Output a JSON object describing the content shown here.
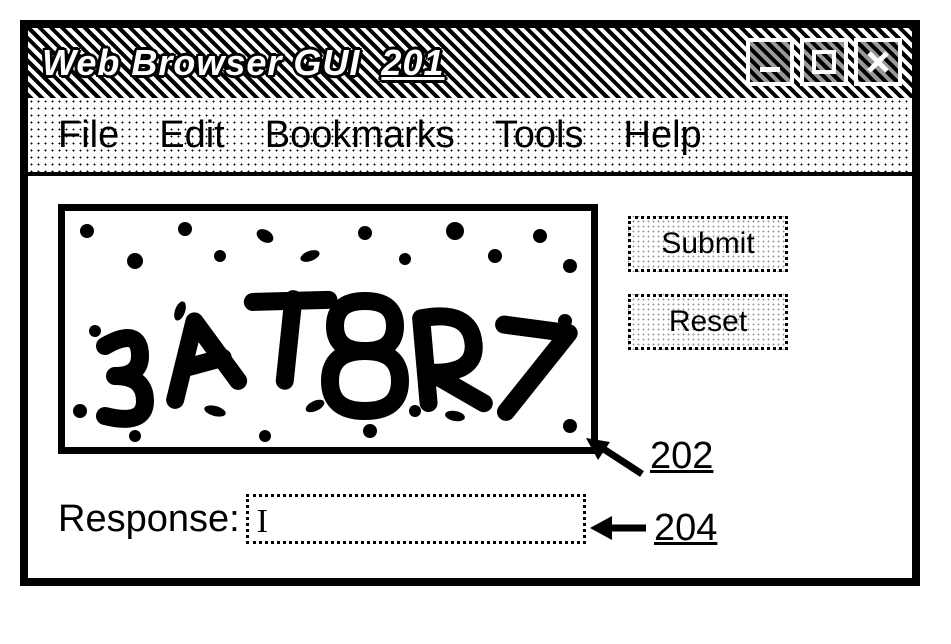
{
  "window": {
    "title": "Web Browser GUI",
    "title_ref": "201"
  },
  "menu": {
    "items": [
      "File",
      "Edit",
      "Bookmarks",
      "Tools",
      "Help"
    ]
  },
  "captcha": {
    "text": "3AT8R7",
    "callout_ref": "202"
  },
  "buttons": {
    "submit": "Submit",
    "reset": "Reset"
  },
  "response": {
    "label": "Response:",
    "value": "",
    "callout_ref": "204"
  }
}
